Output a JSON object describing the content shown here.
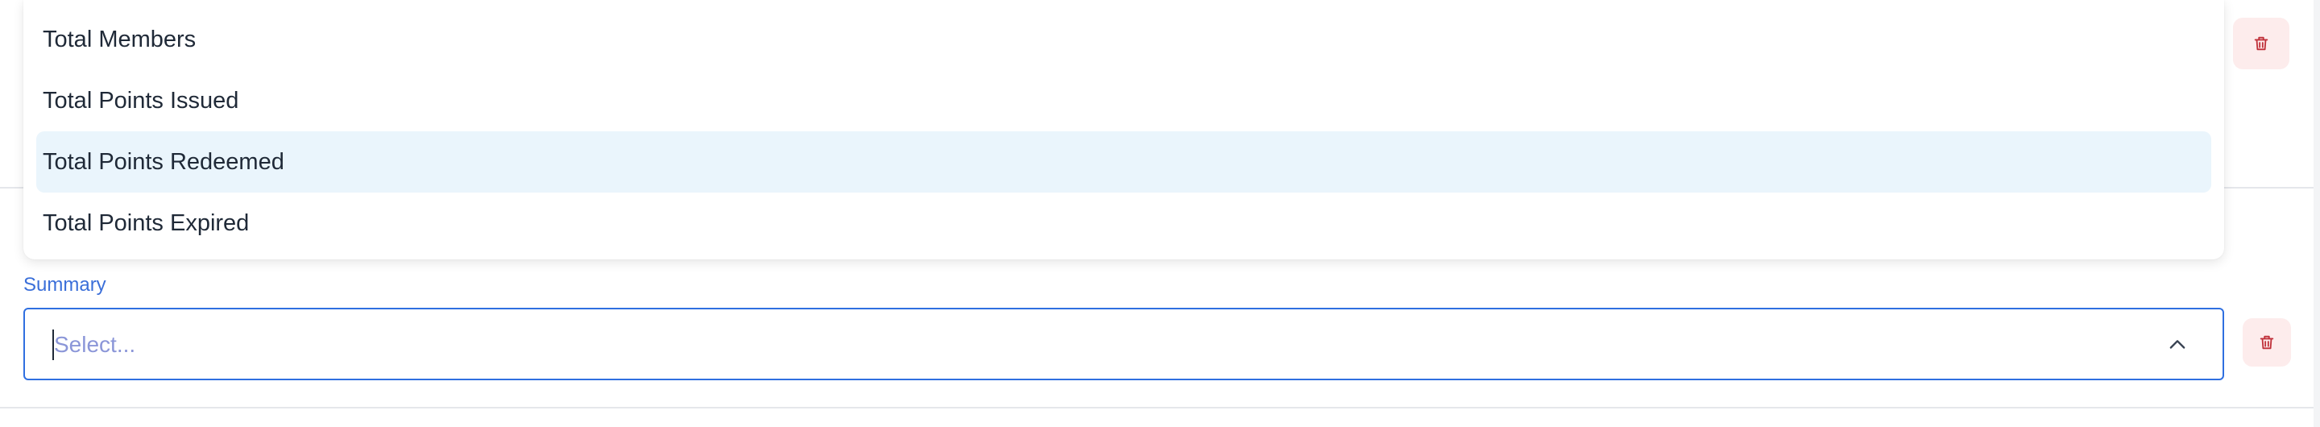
{
  "dropdown": {
    "options": [
      {
        "label": "Total Members",
        "highlighted": false
      },
      {
        "label": "Total Points Issued",
        "highlighted": false
      },
      {
        "label": "Total Points Redeemed",
        "highlighted": true
      },
      {
        "label": "Total Points Expired",
        "highlighted": false
      }
    ]
  },
  "summary": {
    "label": "Summary",
    "placeholder": "Select...",
    "expanded": true
  },
  "icons": {
    "delete": "trash-icon",
    "chevron": "chevron-up-icon"
  },
  "colors": {
    "accent": "#2f6fe0",
    "label": "#3b6fd9",
    "placeholder": "#8b96d8",
    "highlight": "#eaf5fc",
    "delete_bg": "#fdecec",
    "delete_icon": "#c0313a"
  }
}
